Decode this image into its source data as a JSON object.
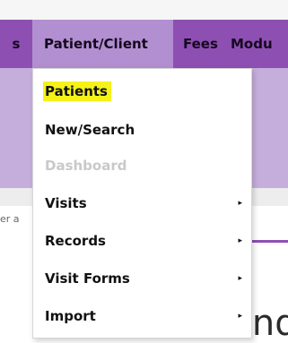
{
  "menubar": {
    "items": [
      {
        "label": "s"
      },
      {
        "label": "Patient/Client"
      },
      {
        "label": "Fees"
      },
      {
        "label": "Modu"
      }
    ]
  },
  "dropdown": {
    "items": [
      {
        "label": "Patients",
        "highlighted": true
      },
      {
        "label": "New/Search"
      },
      {
        "label": "Dashboard",
        "disabled": true
      },
      {
        "label": "Visits",
        "has_submenu": true
      },
      {
        "label": "Records",
        "has_submenu": true
      },
      {
        "label": "Visit Forms",
        "has_submenu": true
      },
      {
        "label": "Import",
        "has_submenu": true
      }
    ],
    "submenu_arrow": "▸"
  },
  "background": {
    "side_label": "er a",
    "heading": "atient Find"
  },
  "colors": {
    "menubar": "#8e4fb3",
    "menubar_active": "#b28fd0",
    "band": "#c6aedc",
    "highlight": "#f5f218",
    "disabled_text": "#c9c9c9"
  }
}
